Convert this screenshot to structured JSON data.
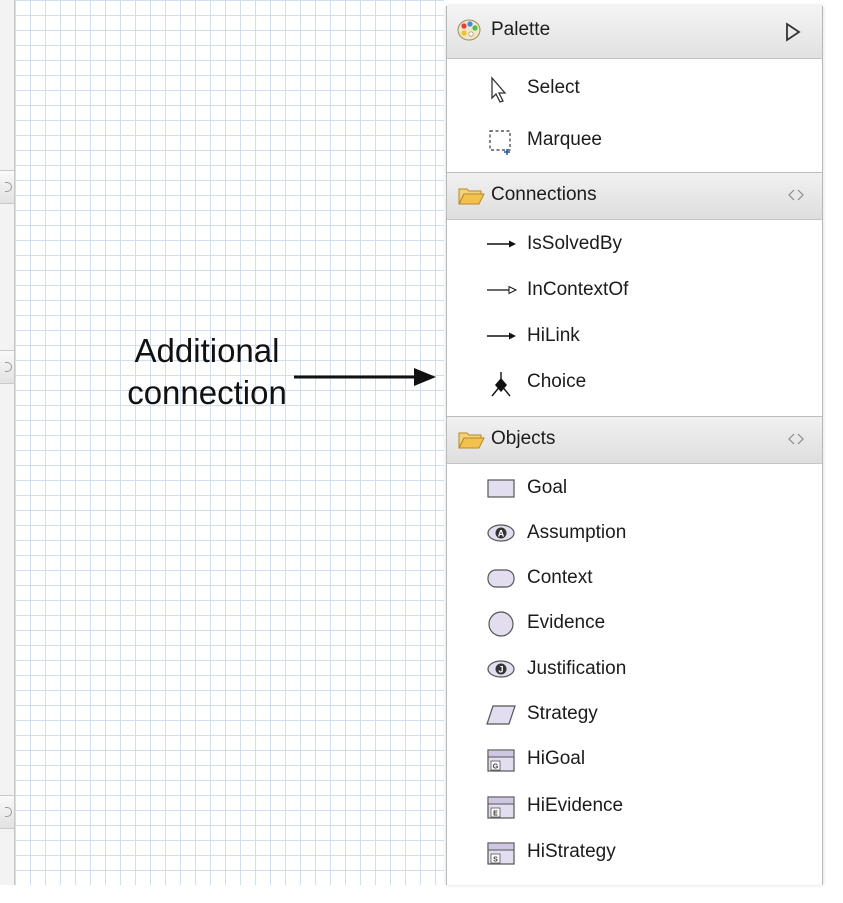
{
  "annotation": {
    "line1": "Additional",
    "line2": "connection"
  },
  "palette": {
    "title": "Palette",
    "tools": [
      {
        "label": "Select",
        "icon": "select-arrow-icon"
      },
      {
        "label": "Marquee",
        "icon": "marquee-icon"
      }
    ],
    "drawers": [
      {
        "label": "Connections",
        "items": [
          {
            "label": "IsSolvedBy",
            "icon": "solid-arrow-icon"
          },
          {
            "label": "InContextOf",
            "icon": "hollow-arrow-icon"
          },
          {
            "label": "HiLink",
            "icon": "solid-arrow-icon"
          },
          {
            "label": "Choice",
            "icon": "choice-icon"
          }
        ]
      },
      {
        "label": "Objects",
        "items": [
          {
            "label": "Goal",
            "icon": "goal-rectangle-icon"
          },
          {
            "label": "Assumption",
            "icon": "assumption-oval-icon",
            "badge": "A"
          },
          {
            "label": "Context",
            "icon": "context-rounded-rect-icon"
          },
          {
            "label": "Evidence",
            "icon": "evidence-circle-icon"
          },
          {
            "label": "Justification",
            "icon": "justification-oval-icon",
            "badge": "J"
          },
          {
            "label": "Strategy",
            "icon": "strategy-parallelogram-icon"
          },
          {
            "label": "HiGoal",
            "icon": "higoal-icon",
            "badge": "G"
          },
          {
            "label": "HiEvidence",
            "icon": "hievidence-icon",
            "badge": "E"
          },
          {
            "label": "HiStrategy",
            "icon": "histrategy-icon",
            "badge": "S"
          }
        ]
      }
    ]
  },
  "colors": {
    "grid": "#cfdff0",
    "header": "#e1e1e1",
    "folder": "#f2c14e",
    "shape_fill": "#e3ddf0"
  }
}
